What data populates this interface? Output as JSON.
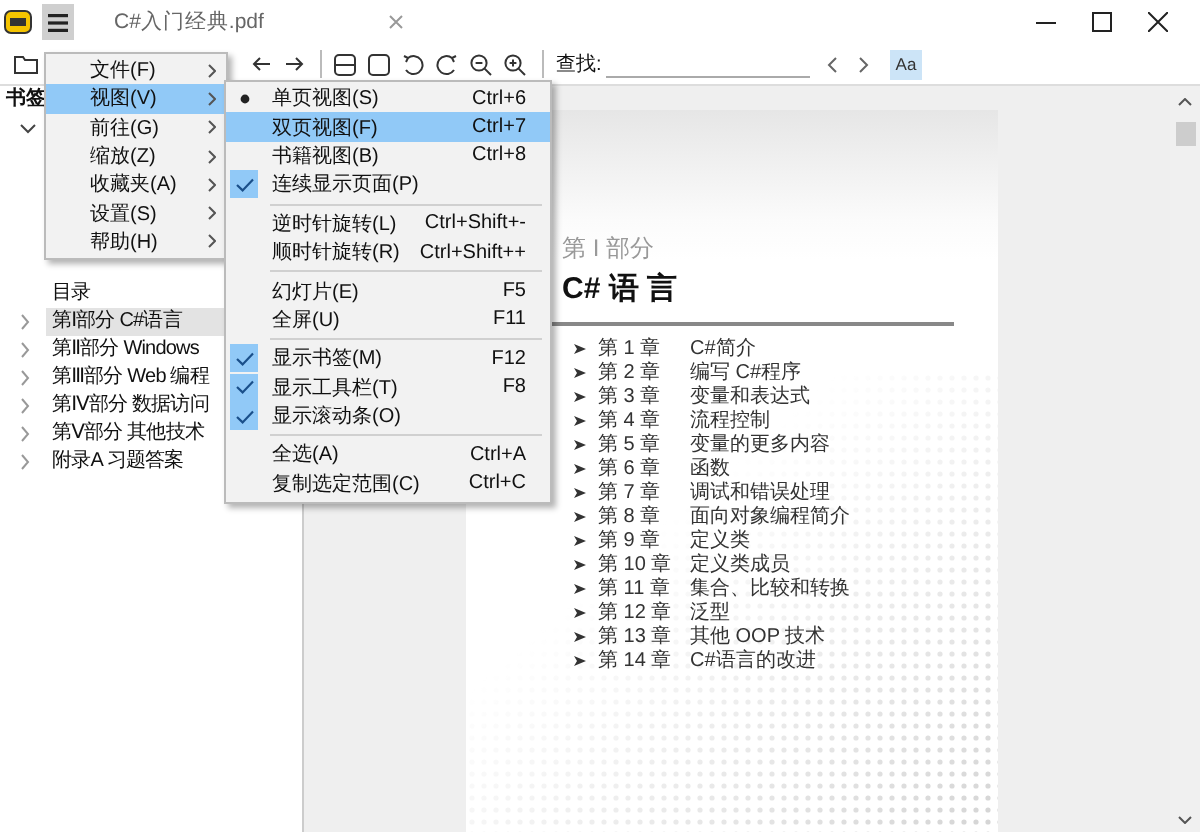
{
  "window": {
    "title": "C#入门经典.pdf"
  },
  "toolbar": {
    "search_label": "查找:",
    "match_case": {
      "label": "Aa",
      "on": true
    }
  },
  "sidebar": {
    "title": "书签",
    "root_expanded": true,
    "items": [
      {
        "label": "目录",
        "selected": false
      },
      {
        "label": "第Ⅰ部分 C#语言",
        "expanded": false,
        "selected": true
      },
      {
        "label": "第Ⅱ部分 Windows",
        "expanded": false,
        "selected": false
      },
      {
        "label": "第Ⅲ部分 Web 编程",
        "expanded": false,
        "selected": false
      },
      {
        "label": "第Ⅳ部分 数据访问",
        "expanded": false,
        "selected": false
      },
      {
        "label": "第Ⅴ部分 其他技术",
        "expanded": false,
        "selected": false
      },
      {
        "label": "附录A 习题答案",
        "expanded": false,
        "selected": false
      }
    ]
  },
  "main_menu": [
    {
      "label": "文件(F)",
      "selected": false
    },
    {
      "label": "视图(V)",
      "selected": true
    },
    {
      "label": "前往(G)",
      "selected": false
    },
    {
      "label": "缩放(Z)",
      "selected": false
    },
    {
      "label": "收藏夹(A)",
      "selected": false
    },
    {
      "label": "设置(S)",
      "selected": false
    },
    {
      "label": "帮助(H)",
      "selected": false
    }
  ],
  "view_menu": [
    {
      "kind": "radio",
      "label": "单页视图(S)",
      "shortcut": "Ctrl+6",
      "checked": true,
      "selected": false
    },
    {
      "kind": "radio",
      "label": "双页视图(F)",
      "shortcut": "Ctrl+7",
      "checked": false,
      "selected": true
    },
    {
      "kind": "radio",
      "label": "书籍视图(B)",
      "shortcut": "Ctrl+8",
      "checked": false,
      "selected": false
    },
    {
      "kind": "check",
      "label": "连续显示页面(P)",
      "checked": true,
      "selected": false
    },
    {
      "kind": "separator"
    },
    {
      "kind": "plain",
      "label": "逆时针旋转(L)",
      "shortcut": "Ctrl+Shift+-",
      "selected": false
    },
    {
      "kind": "plain",
      "label": "顺时针旋转(R)",
      "shortcut": "Ctrl+Shift++",
      "selected": false
    },
    {
      "kind": "separator"
    },
    {
      "kind": "plain",
      "label": "幻灯片(E)",
      "shortcut": "F5",
      "selected": false
    },
    {
      "kind": "plain",
      "label": "全屏(U)",
      "shortcut": "F11",
      "selected": false
    },
    {
      "kind": "separator"
    },
    {
      "kind": "check",
      "label": "显示书签(M)",
      "shortcut": "F12",
      "checked": true,
      "selected": false
    },
    {
      "kind": "check",
      "label": "显示工具栏(T)",
      "shortcut": "F8",
      "checked": true,
      "selected": false
    },
    {
      "kind": "check",
      "label": "显示滚动条(O)",
      "checked": true,
      "selected": false
    },
    {
      "kind": "separator"
    },
    {
      "kind": "plain",
      "label": "全选(A)",
      "shortcut": "Ctrl+A",
      "selected": false
    },
    {
      "kind": "plain",
      "label": "复制选定范围(C)",
      "shortcut": "Ctrl+C",
      "selected": false
    }
  ],
  "document": {
    "part": "第 I 部分",
    "title": "C# 语 言",
    "chapters": [
      {
        "number": "第 1 章",
        "title": "C#简介"
      },
      {
        "number": "第 2 章",
        "title": "编写 C#程序"
      },
      {
        "number": "第 3 章",
        "title": "变量和表达式"
      },
      {
        "number": "第 4 章",
        "title": "流程控制"
      },
      {
        "number": "第 5 章",
        "title": "变量的更多内容"
      },
      {
        "number": "第 6 章",
        "title": "函数"
      },
      {
        "number": "第 7 章",
        "title": "调试和错误处理"
      },
      {
        "number": "第 8 章",
        "title": "面向对象编程简介"
      },
      {
        "number": "第 9 章",
        "title": "定义类"
      },
      {
        "number": "第 10 章",
        "title": "定义类成员"
      },
      {
        "number": "第 11 章",
        "title": "集合、比较和转换"
      },
      {
        "number": "第 12 章",
        "title": "泛型"
      },
      {
        "number": "第 13 章",
        "title": "其他 OOP 技术"
      },
      {
        "number": "第 14 章",
        "title": "C#语言的改进"
      }
    ]
  }
}
